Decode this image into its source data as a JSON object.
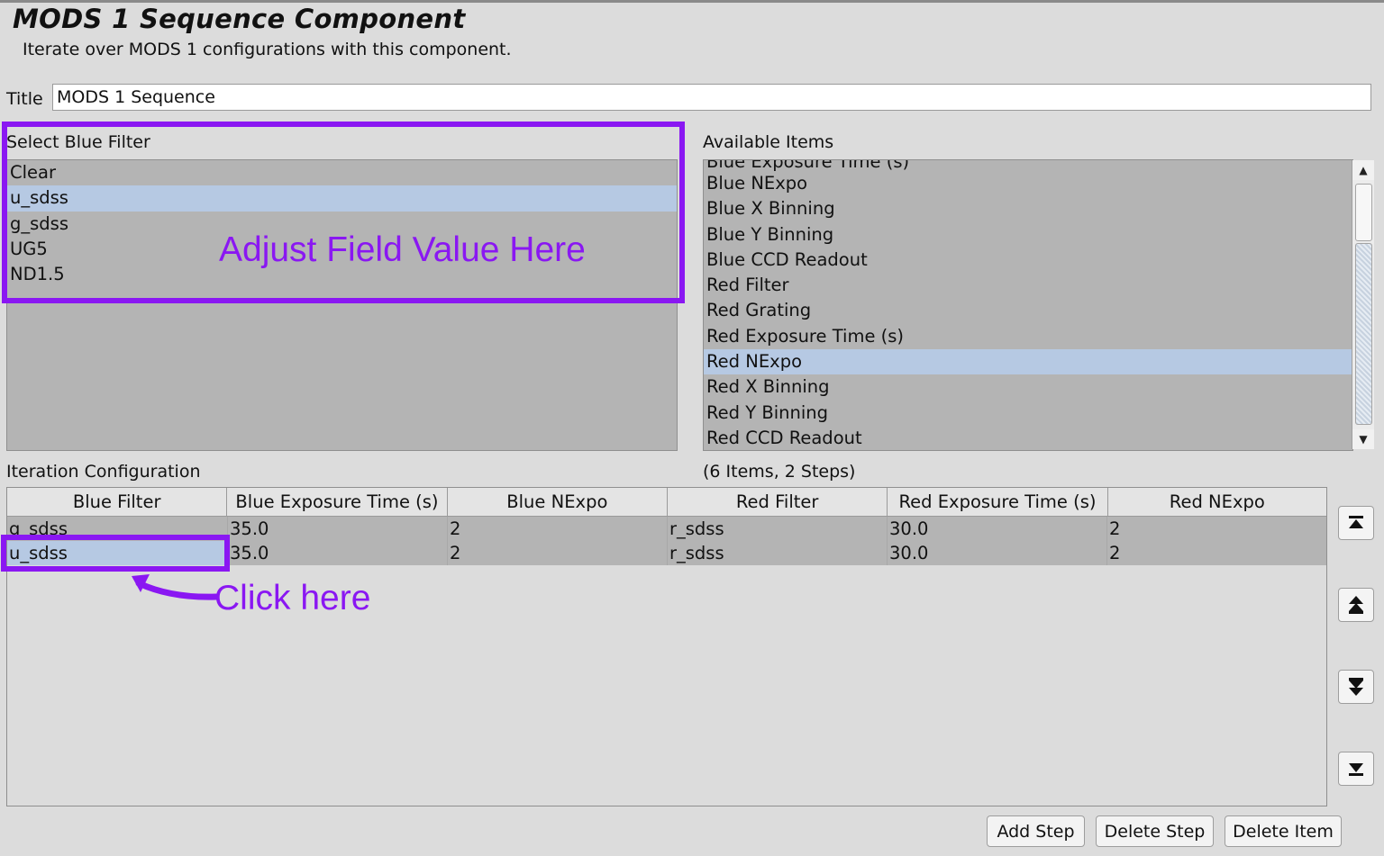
{
  "header": {
    "title": "MODS 1 Sequence Component",
    "description": "Iterate over MODS 1 configurations with this component."
  },
  "title_field": {
    "label": "Title",
    "value": "MODS 1 Sequence"
  },
  "blue_filter": {
    "label": "Select Blue Filter",
    "items": [
      "Clear",
      "u_sdss",
      "g_sdss",
      "UG5",
      "ND1.5"
    ],
    "selected": "u_sdss"
  },
  "available_items": {
    "label": "Available Items",
    "partial_item": "Blue Exposure Time (s)",
    "items": [
      "Blue NExpo",
      "Blue X Binning",
      "Blue Y Binning",
      "Blue CCD Readout",
      "Red Filter",
      "Red Grating",
      "Red Exposure Time (s)",
      "Red NExpo",
      "Red X Binning",
      "Red Y Binning",
      "Red CCD Readout"
    ],
    "selected": "Red NExpo"
  },
  "iteration": {
    "label": "Iteration Configuration",
    "summary": "(6 Items, 2 Steps)",
    "columns": [
      "Blue Filter",
      "Blue Exposure Time (s)",
      "Blue NExpo",
      "Red Filter",
      "Red Exposure Time (s)",
      "Red NExpo"
    ],
    "rows": [
      [
        "g_sdss",
        "35.0",
        "2",
        "r_sdss",
        "30.0",
        "2"
      ],
      [
        "u_sdss",
        "35.0",
        "2",
        "r_sdss",
        "30.0",
        "2"
      ]
    ]
  },
  "side_buttons": [
    "move-to-top",
    "move-up",
    "move-down",
    "move-to-bottom"
  ],
  "buttons": {
    "add_step": "Add Step",
    "delete_step": "Delete Step",
    "delete_item": "Delete Item"
  },
  "annotations": {
    "adjust": "Adjust Field Value Here",
    "click": "Click here",
    "color": "#8a17f2"
  }
}
